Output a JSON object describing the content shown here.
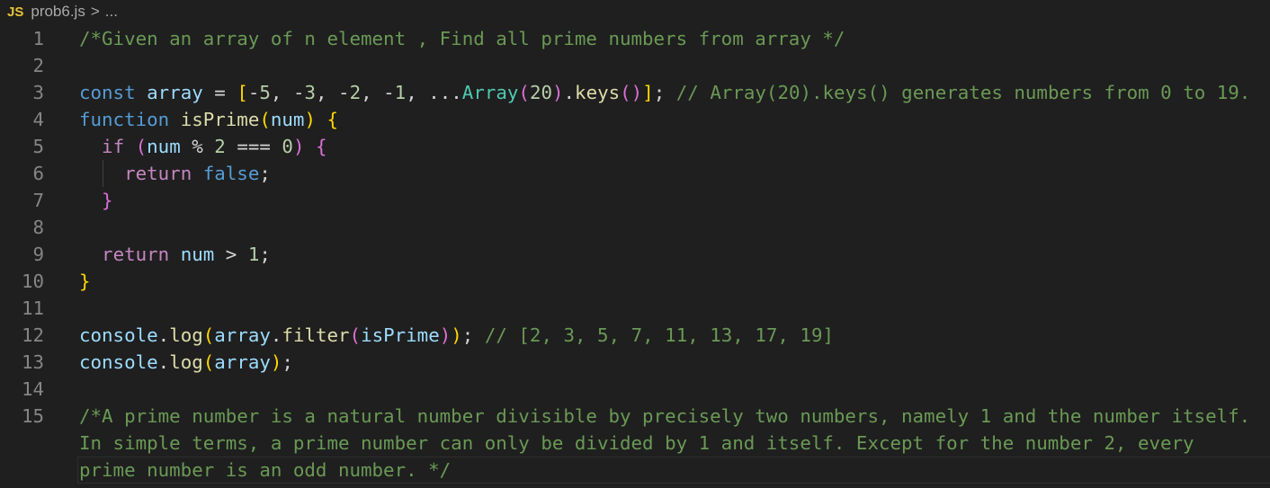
{
  "breadcrumb": {
    "lang_icon": "JS",
    "file": "prob6.js",
    "separator": ">",
    "more": "..."
  },
  "colors": {
    "comment": "#6a9955",
    "keyword": "#569cd6",
    "variable": "#9cdcfe",
    "function": "#dcdcaa",
    "control": "#c586c0",
    "number": "#b5cea8",
    "class": "#4ec9b0",
    "bracket1": "#ffd700",
    "bracket2": "#da70d6"
  },
  "lines": [
    {
      "n": "1",
      "tokens": [
        [
          "/*Given an array of n element , Find all prime numbers from array */",
          "comment"
        ]
      ]
    },
    {
      "n": "2",
      "tokens": []
    },
    {
      "n": "3",
      "tokens": [
        [
          "const",
          "kw"
        ],
        [
          " ",
          "op"
        ],
        [
          "array",
          "var"
        ],
        [
          " = ",
          "op"
        ],
        [
          "[",
          "b1"
        ],
        [
          "-",
          "op"
        ],
        [
          "5",
          "num"
        ],
        [
          ", -",
          "op"
        ],
        [
          "3",
          "num"
        ],
        [
          ", -",
          "op"
        ],
        [
          "2",
          "num"
        ],
        [
          ", -",
          "op"
        ],
        [
          "1",
          "num"
        ],
        [
          ", ...",
          "op"
        ],
        [
          "Array",
          "cls"
        ],
        [
          "(",
          "b2"
        ],
        [
          "20",
          "num"
        ],
        [
          ")",
          "b2"
        ],
        [
          ".",
          "op"
        ],
        [
          "keys",
          "fn"
        ],
        [
          "()",
          "b2"
        ],
        [
          "]",
          "b1"
        ],
        [
          "; ",
          "op"
        ],
        [
          "// Array(20).keys() generates numbers from 0 to 19.",
          "comment"
        ]
      ]
    },
    {
      "n": "4",
      "tokens": [
        [
          "function",
          "kw"
        ],
        [
          " ",
          "op"
        ],
        [
          "isPrime",
          "fn"
        ],
        [
          "(",
          "b1"
        ],
        [
          "num",
          "var"
        ],
        [
          ")",
          "b1"
        ],
        [
          " ",
          "op"
        ],
        [
          "{",
          "b1"
        ]
      ]
    },
    {
      "n": "5",
      "tokens": [
        [
          "  ",
          "op"
        ],
        [
          "if",
          "ctl"
        ],
        [
          " ",
          "op"
        ],
        [
          "(",
          "b2"
        ],
        [
          "num",
          "var"
        ],
        [
          " % ",
          "op"
        ],
        [
          "2",
          "num"
        ],
        [
          " === ",
          "op"
        ],
        [
          "0",
          "num"
        ],
        [
          ")",
          "b2"
        ],
        [
          " ",
          "op"
        ],
        [
          "{",
          "b2"
        ]
      ]
    },
    {
      "n": "6",
      "tokens": [
        [
          "    ",
          "op"
        ],
        [
          "return",
          "ctl"
        ],
        [
          " ",
          "op"
        ],
        [
          "false",
          "kw"
        ],
        [
          ";",
          "op"
        ]
      ]
    },
    {
      "n": "7",
      "tokens": [
        [
          "  ",
          "op"
        ],
        [
          "}",
          "b2"
        ]
      ]
    },
    {
      "n": "8",
      "tokens": []
    },
    {
      "n": "9",
      "tokens": [
        [
          "  ",
          "op"
        ],
        [
          "return",
          "ctl"
        ],
        [
          " ",
          "op"
        ],
        [
          "num",
          "var"
        ],
        [
          " > ",
          "op"
        ],
        [
          "1",
          "num"
        ],
        [
          ";",
          "op"
        ]
      ]
    },
    {
      "n": "10",
      "tokens": [
        [
          "}",
          "b1"
        ]
      ]
    },
    {
      "n": "11",
      "tokens": []
    },
    {
      "n": "12",
      "tokens": [
        [
          "console",
          "var"
        ],
        [
          ".",
          "op"
        ],
        [
          "log",
          "fn"
        ],
        [
          "(",
          "b1"
        ],
        [
          "array",
          "var"
        ],
        [
          ".",
          "op"
        ],
        [
          "filter",
          "fn"
        ],
        [
          "(",
          "b2"
        ],
        [
          "isPrime",
          "var"
        ],
        [
          ")",
          "b2"
        ],
        [
          ")",
          "b1"
        ],
        [
          "; ",
          "op"
        ],
        [
          "// [2, 3, 5, 7, 11, 13, 17, 19]",
          "comment"
        ]
      ]
    },
    {
      "n": "13",
      "tokens": [
        [
          "console",
          "var"
        ],
        [
          ".",
          "op"
        ],
        [
          "log",
          "fn"
        ],
        [
          "(",
          "b1"
        ],
        [
          "array",
          "var"
        ],
        [
          ")",
          "b1"
        ],
        [
          ";",
          "op"
        ]
      ]
    },
    {
      "n": "14",
      "tokens": []
    },
    {
      "n": "15",
      "tokens": [
        [
          "/*A prime number is a natural number divisible by precisely two numbers, namely 1 and the number itself.",
          "comment"
        ]
      ]
    },
    {
      "n": "",
      "tokens": [
        [
          "In simple terms, a prime number can only be divided by 1 and itself. Except for the number 2, every",
          "comment"
        ]
      ]
    },
    {
      "n": "",
      "tokens": [
        [
          "prime number is an odd number. */",
          "comment"
        ]
      ]
    }
  ]
}
